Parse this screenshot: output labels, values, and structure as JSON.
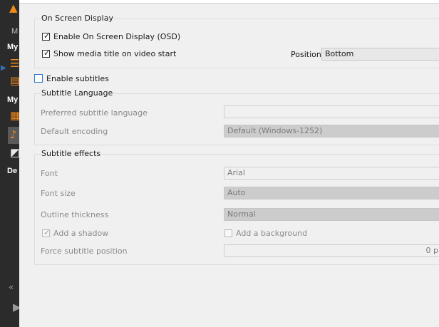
{
  "sidebar": {
    "items": [
      {
        "label": "M"
      },
      {
        "label": "My"
      },
      {
        "label": "My"
      },
      {
        "label": "De"
      }
    ],
    "icons": [
      "vlc-cone-icon",
      "playlist-icon",
      "library-icon",
      "video-icon",
      "music-icon",
      "picture-icon",
      "rewind-icon",
      "play-icon"
    ]
  },
  "osd": {
    "title": "On Screen Display",
    "enable_osd_label": "Enable On Screen Display (OSD)",
    "enable_osd_checked": true,
    "show_title_label": "Show media title on video start",
    "show_title_checked": true,
    "position_label": "Position",
    "position_value": "Bottom"
  },
  "subtitles": {
    "enable_label": "Enable subtitles",
    "enable_checked": false
  },
  "language": {
    "title": "Subtitle Language",
    "preferred_label": "Preferred subtitle language",
    "preferred_value": "",
    "encoding_label": "Default encoding",
    "encoding_value": "Default (Windows-1252)"
  },
  "effects": {
    "title": "Subtitle effects",
    "font_label": "Font",
    "font_value": "Arial",
    "font_size_label": "Font size",
    "font_size_value": "Auto",
    "outline_label": "Outline thickness",
    "outline_value": "Normal",
    "shadow_label": "Add a shadow",
    "shadow_checked": true,
    "background_label": "Add a background",
    "background_checked": false,
    "force_position_label": "Force subtitle position",
    "force_position_value": "0 p"
  }
}
